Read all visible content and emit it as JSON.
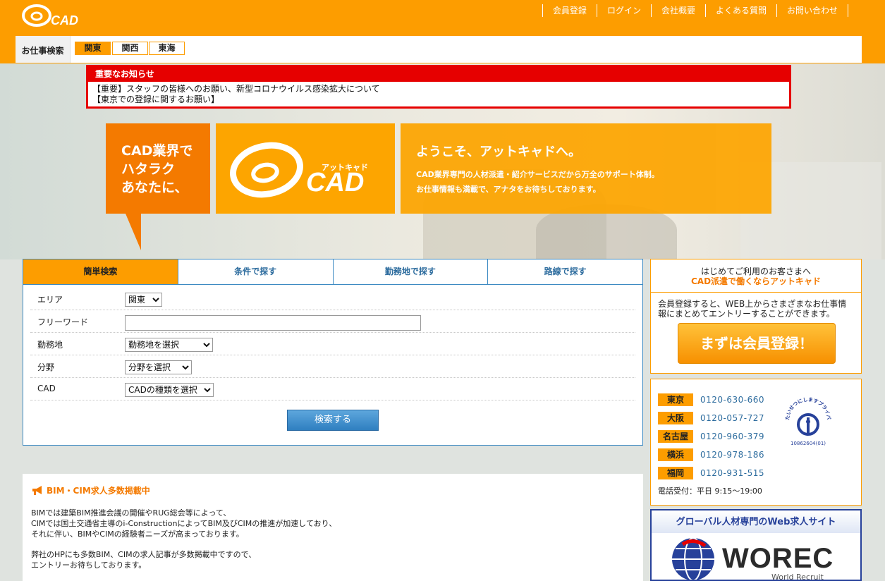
{
  "header": {
    "logo_text": "@CAD",
    "nav": [
      "会員登録",
      "ログイン",
      "会社概要",
      "よくある質問",
      "お問い合わせ"
    ]
  },
  "job_search": {
    "label": "お仕事検索",
    "regions": [
      "関東",
      "関西",
      "東海"
    ],
    "active_region": "関東"
  },
  "notice": {
    "title": "重要なお知らせ",
    "items": [
      "【重要】スタッフの皆様へのお願い、新型コロナウイルス感染拡大について",
      "【東京での登録に関するお願い】"
    ]
  },
  "hero": {
    "catch_lines": [
      "CAD業界で",
      "ハタラク",
      "あなたに、"
    ],
    "logo_kana": "アットキャド",
    "logo_text": "CAD",
    "welcome": "ようこそ、アットキャドへ。",
    "desc_lines": [
      "CAD業界専門の人材派遣・紹介サービスだから万全のサポート体制。",
      "お仕事情報も満載で、アナタをお待ちしております。"
    ]
  },
  "search": {
    "tabs": [
      "簡単検索",
      "条件で探す",
      "勤務地で探す",
      "路線で探す"
    ],
    "active_tab": "簡単検索",
    "fields": {
      "area_label": "エリア",
      "area_value": "関東",
      "freeword_label": "フリーワード",
      "freeword_value": "",
      "location_label": "勤務地",
      "location_value": "勤務地を選択",
      "field_label": "分野",
      "field_value": "分野を選択",
      "cad_label": "CAD",
      "cad_value": "CADの種類を選択"
    },
    "button": "検索する"
  },
  "bim": {
    "title": "BIM・CIM求人多数掲載中",
    "para1": [
      "BIMでは建築BIM推進会議の開催やRUG総会等によって、",
      "CIMでは国土交通省主導のi-ConstructionによってBIM及びCIMの推進が加速しており、",
      "それに伴い、BIMやCIMの経験者ニーズが高まっております。"
    ],
    "para2": [
      "弊社のHPにも多数BIM、CIMの求人記事が多数掲載中ですので、",
      "エントリーお待ちしております。"
    ]
  },
  "register": {
    "line1": "はじめてご利用のお客さまへ",
    "line2": "CAD派遣で働くならアットキャド",
    "line3": "会員登録すると、WEB上からさまざまなお仕事情報にまとめてエントリーすることができます。",
    "button": "まずは会員登録！"
  },
  "phones": {
    "list": [
      {
        "city": "東京",
        "tel": "0120-630-660"
      },
      {
        "city": "大阪",
        "tel": "0120-057-727"
      },
      {
        "city": "名古屋",
        "tel": "0120-960-379"
      },
      {
        "city": "横浜",
        "tel": "0120-978-186"
      },
      {
        "city": "福岡",
        "tel": "0120-931-515"
      }
    ],
    "hours": "電話受付：平日 9:15〜19:00",
    "privacy_mark": {
      "arc_text": "たいせつにしますプライバシー",
      "number": "10862604(01)"
    }
  },
  "worec": {
    "title": "グローバル人材専門のWeb求人サイト",
    "name": "WOREC",
    "sub": "World Recruit"
  },
  "colors": {
    "brand_orange": "#fd9d00",
    "accent_orange": "#f47a00",
    "notice_red": "#e60000",
    "link_blue": "#2d6c9e",
    "worec_blue": "#27419a"
  }
}
